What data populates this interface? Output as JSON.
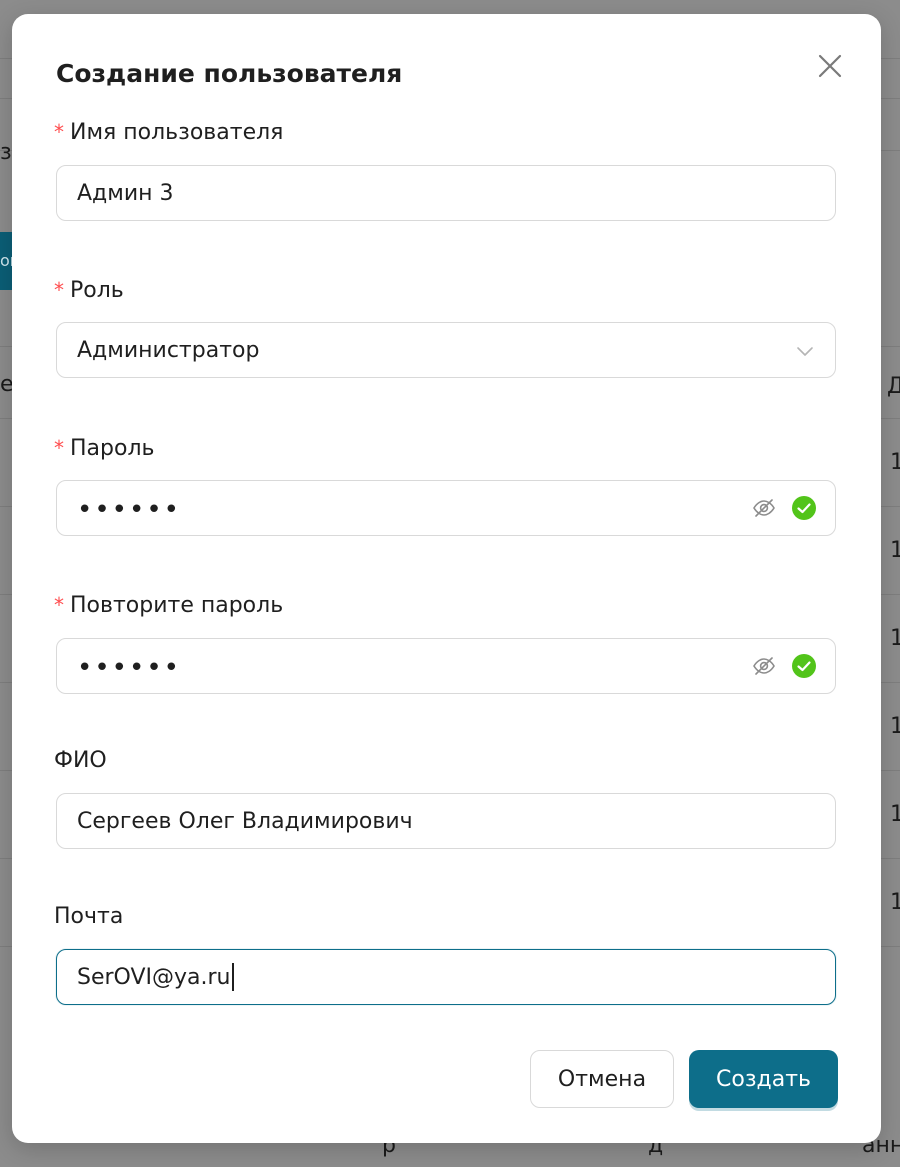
{
  "background": {
    "fragments": [
      "за",
      "ов",
      "ел",
      "Д",
      "1",
      "1",
      "1",
      "1",
      "1",
      "1",
      "р",
      "д",
      "анн"
    ]
  },
  "modal": {
    "title": "Создание пользователя",
    "fields": {
      "username": {
        "label": "Имя пользователя",
        "required": true,
        "value": "Админ 3"
      },
      "role": {
        "label": "Роль",
        "required": true,
        "value": "Администратор"
      },
      "password": {
        "label": "Пароль",
        "required": true,
        "value": "••••••"
      },
      "password_repeat": {
        "label": "Повторите пароль",
        "required": true,
        "value": "••••••"
      },
      "full_name": {
        "label": "ФИО",
        "required": false,
        "value": "Сергеев Олег Владимирович"
      },
      "email": {
        "label": "Почта",
        "required": false,
        "value": "SerOVI@ya.ru"
      }
    },
    "buttons": {
      "cancel": "Отмена",
      "create": "Создать"
    }
  },
  "colors": {
    "primary": "#0d6e8a",
    "required": "#ff4d4f",
    "success": "#52c41a"
  },
  "icons": {
    "close": "close-icon",
    "select": "chevron-down-icon",
    "toggle_visibility": "eye-invisible-icon",
    "valid": "check-circle-icon"
  }
}
